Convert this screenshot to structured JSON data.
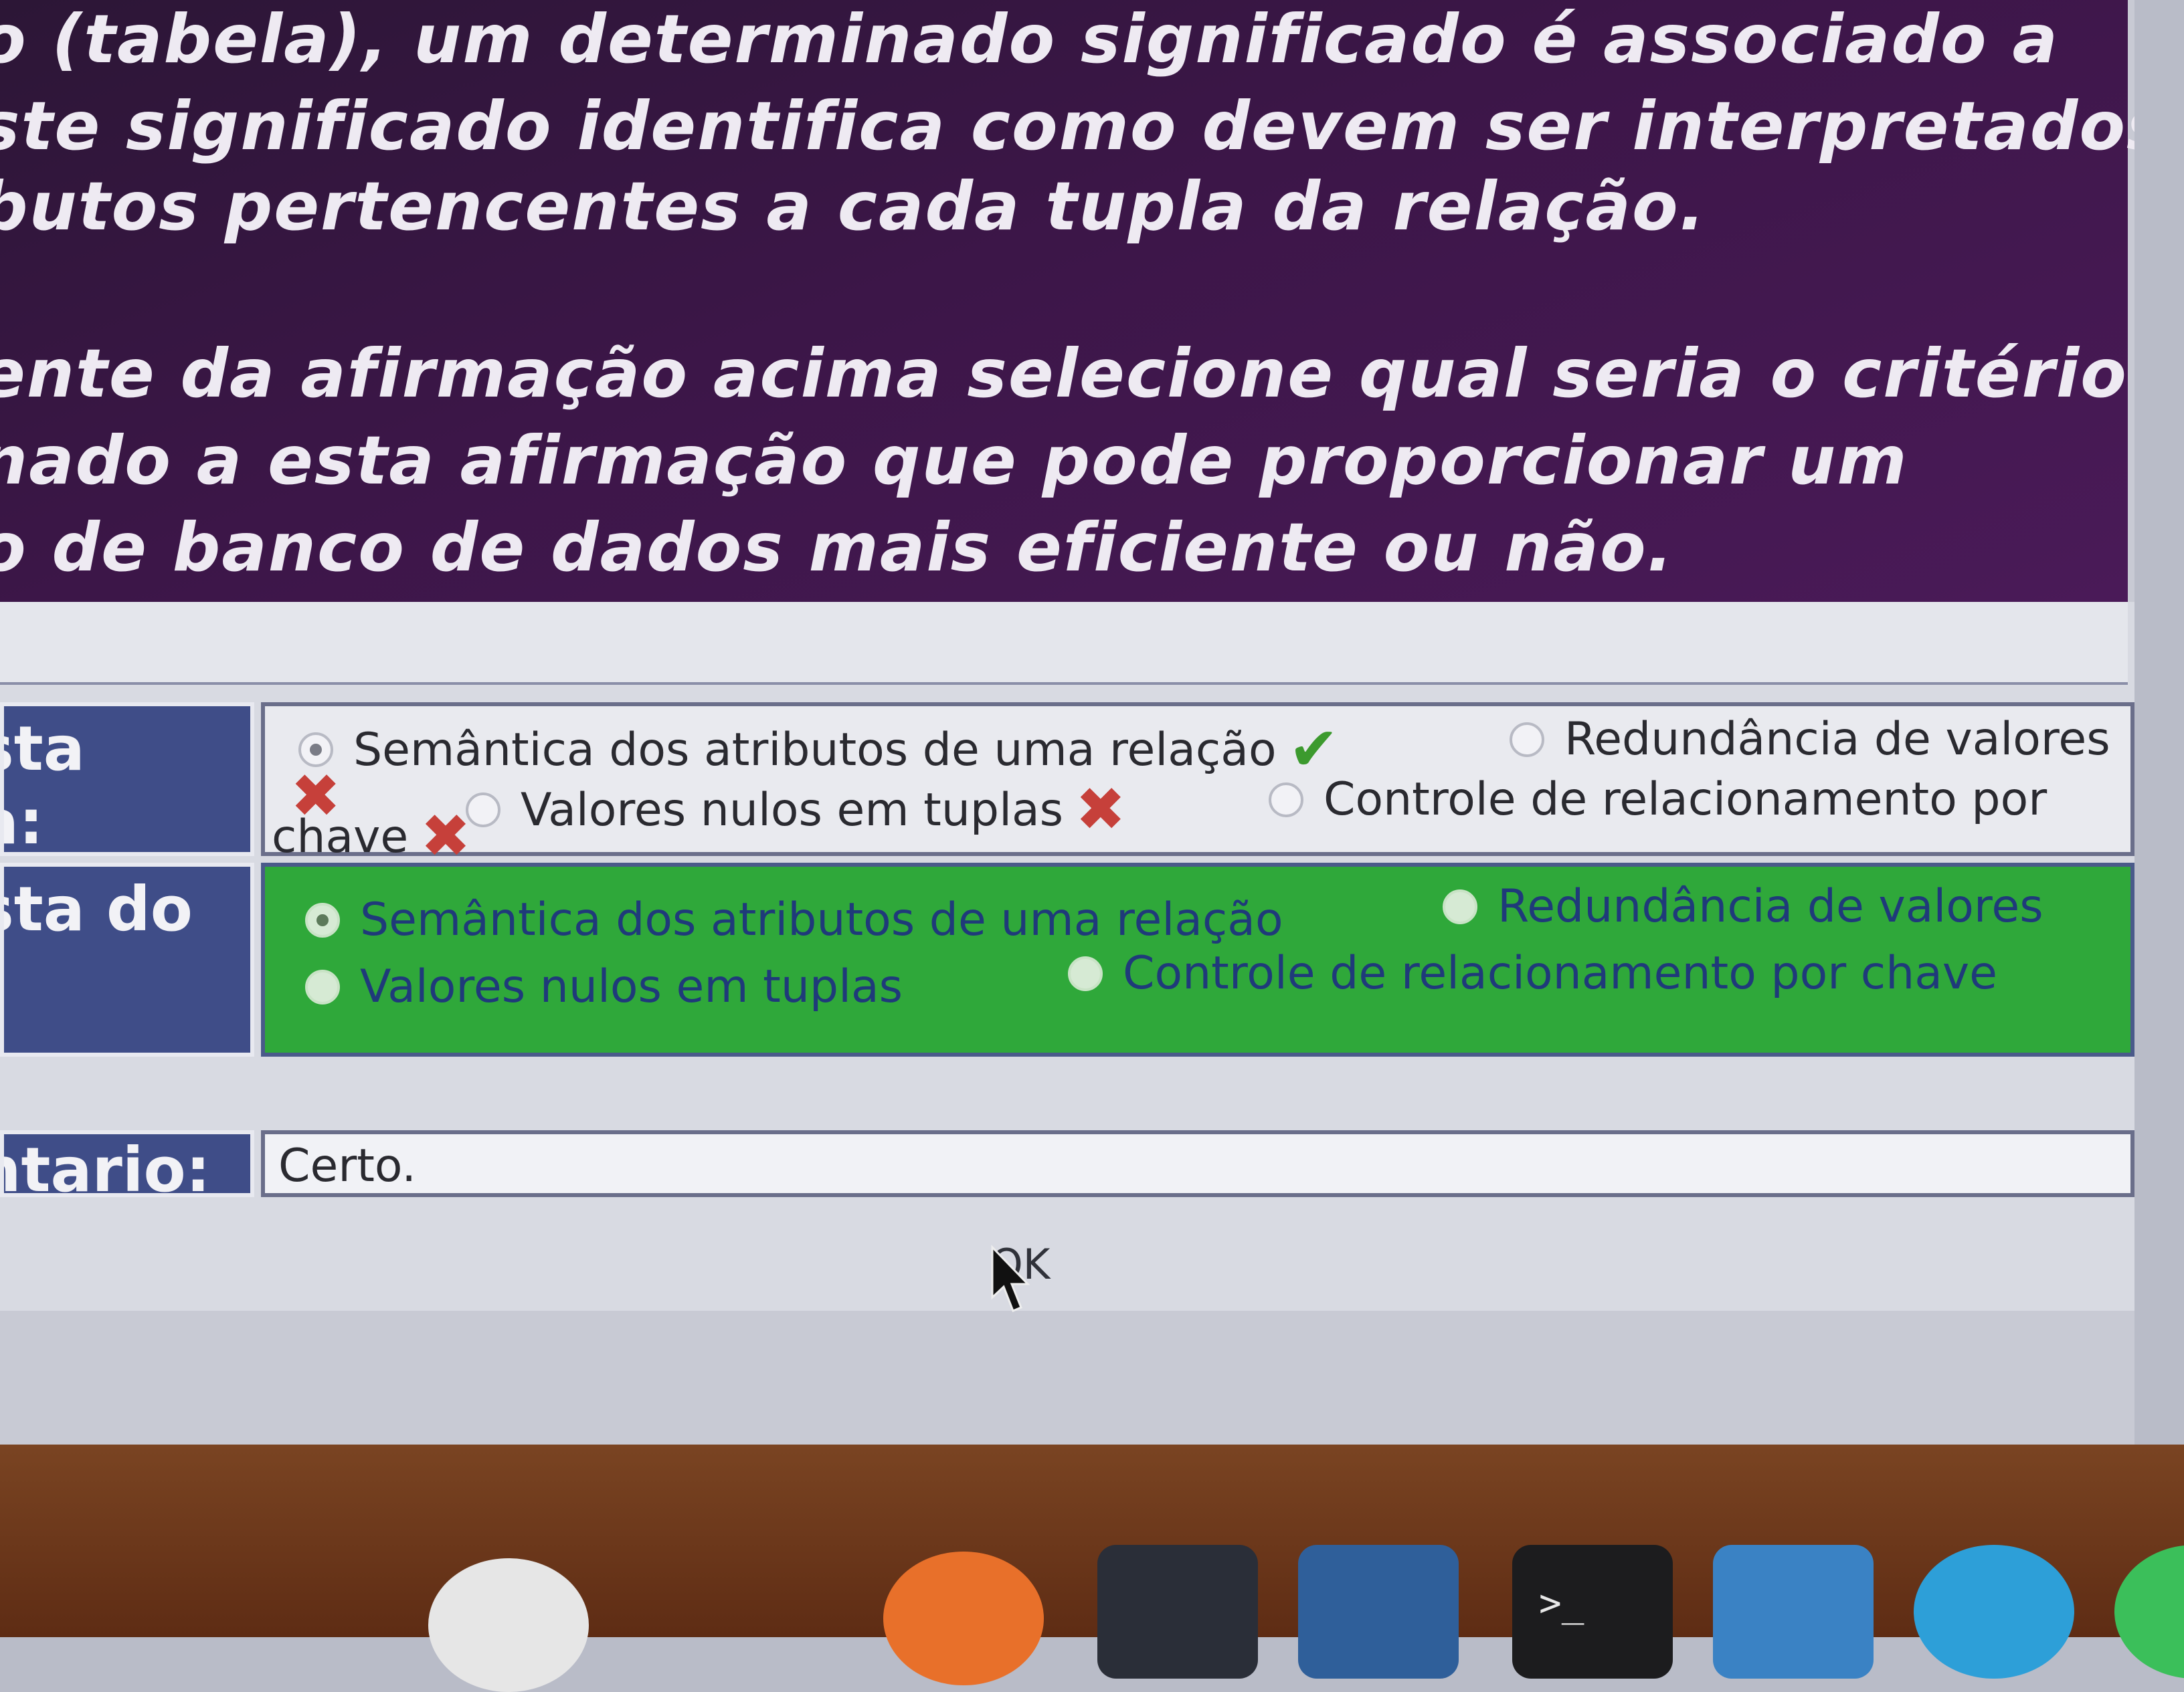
{
  "question": {
    "lines": [
      "o (tabela), um determinado significado é associado a",
      "ste significado identifica como devem ser interpretados",
      "butos pertencentes a cada tupla da relação.",
      "ente da afirmação acima selecione qual seria o critério",
      "nado a esta afirmação que pode proporcionar um",
      "o de banco de dados mais eficiente ou não."
    ]
  },
  "rows": {
    "user_answer": {
      "label_line1": "sta",
      "label_line2": "a:",
      "options": [
        {
          "label": "Semântica dos atributos de uma relação",
          "selected": true,
          "mark": "✔"
        },
        {
          "label": "Redundância de valores",
          "selected": false,
          "mark": "✖"
        },
        {
          "label": "Valores nulos em tuplas",
          "selected": false,
          "mark": "✖"
        },
        {
          "label": "Controle de relacionamento por",
          "label_cont": "chave",
          "selected": false,
          "mark": "✖"
        }
      ]
    },
    "correct_answer": {
      "label": "sta do",
      "options": [
        {
          "label": "Semântica dos atributos de uma relação",
          "selected": true
        },
        {
          "label": "Redundância de valores",
          "selected": false
        },
        {
          "label": "Valores nulos em tuplas",
          "selected": false
        },
        {
          "label": "Controle de relacionamento por chave",
          "selected": false
        }
      ]
    },
    "comment": {
      "label": "ntario:",
      "value": "Certo."
    }
  },
  "ok_button": {
    "label": "OK"
  },
  "dock": {
    "terminal_prompt": ">_"
  },
  "colors": {
    "question_bg": "#3c1648",
    "label_bg": "#3f4d88",
    "correct_bg": "#2fa83a",
    "check_mark": "#3c9a2e",
    "wrong_mark": "#c6403a"
  }
}
